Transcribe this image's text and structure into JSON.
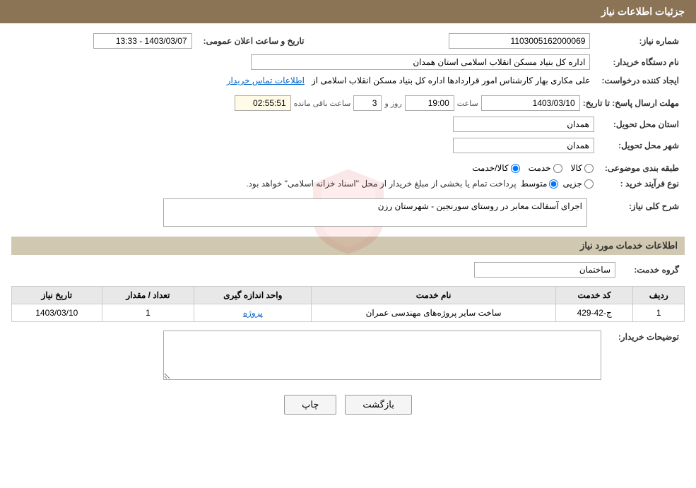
{
  "header": {
    "title": "جزئیات اطلاعات نیاز"
  },
  "fields": {
    "need_number_label": "شماره نیاز:",
    "need_number_value": "1103005162000069",
    "public_announce_label": "تاریخ و ساعت اعلان عمومی:",
    "public_announce_value": "1403/03/07 - 13:33",
    "buyer_org_label": "نام دستگاه خریدار:",
    "buyer_org_value": "اداره کل بنیاد مسکن انقلاب اسلامی استان همدان",
    "requester_label": "ایجاد کننده درخواست:",
    "requester_value": "علی مکاری بهار کارشناس امور قراردادها اداره کل بنیاد مسکن انقلاب اسلامی از",
    "requester_link": "اطلاعات تماس خریدار",
    "deadline_label": "مهلت ارسال پاسخ: تا تاریخ:",
    "deadline_date": "1403/03/10",
    "deadline_time_label": "ساعت",
    "deadline_time": "19:00",
    "deadline_days_label": "روز و",
    "deadline_days": "3",
    "deadline_remaining_label": "ساعت باقی مانده",
    "deadline_remaining": "02:55:51",
    "province_label": "استان محل تحویل:",
    "province_value": "همدان",
    "city_label": "شهر محل تحویل:",
    "city_value": "همدان",
    "category_label": "طبقه بندی موضوعی:",
    "category_kala": "کالا",
    "category_khadamat": "خدمت",
    "category_kala_khadamat": "کالا/خدمت",
    "category_selected": "kala_khadamat",
    "purchase_type_label": "نوع فرآیند خرید :",
    "purchase_jozi": "جزیی",
    "purchase_mottavaset": "متوسط",
    "purchase_description": "پرداخت تمام یا بخشی از مبلغ خریدار از محل \"اسناد خزانه اسلامی\" خواهد بود.",
    "need_description_label": "شرح کلی نیاز:",
    "need_description_value": "اجرای آسفالت معابر در روستای سورنجین - شهرستان رزن",
    "services_section_label": "اطلاعات خدمات مورد نیاز",
    "service_group_label": "گروه خدمت:",
    "service_group_value": "ساختمان",
    "table": {
      "headers": [
        "ردیف",
        "کد خدمت",
        "نام خدمت",
        "واحد اندازه گیری",
        "تعداد / مقدار",
        "تاریخ نیاز"
      ],
      "rows": [
        {
          "row": "1",
          "code": "ج-42-429",
          "name": "ساخت سایر پروژه‌های مهندسی عمران",
          "unit": "پروژه",
          "quantity": "1",
          "date": "1403/03/10"
        }
      ]
    },
    "buyer_notes_label": "توضیحات خریدار:",
    "buyer_notes_value": ""
  },
  "buttons": {
    "print_label": "چاپ",
    "back_label": "بازگشت"
  }
}
